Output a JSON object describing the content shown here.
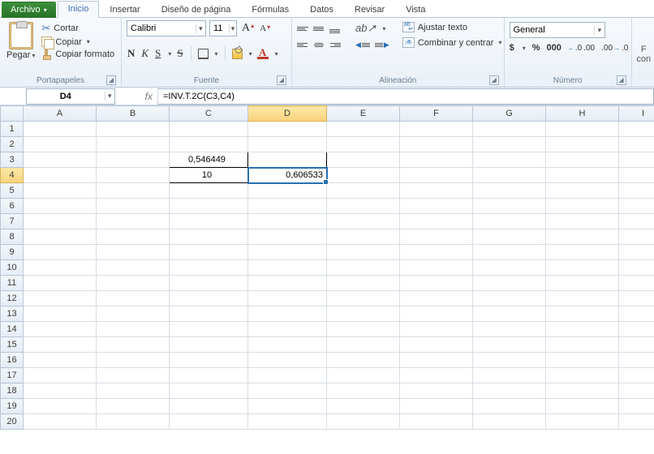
{
  "tabs": {
    "file": "Archivo",
    "items": [
      "Inicio",
      "Insertar",
      "Diseño de página",
      "Fórmulas",
      "Datos",
      "Revisar",
      "Vista"
    ],
    "active": 0
  },
  "ribbon": {
    "clipboard": {
      "label": "Portapapeles",
      "paste": "Pegar",
      "cut": "Cortar",
      "copy": "Copiar",
      "format_painter": "Copiar formato"
    },
    "font": {
      "label": "Fuente",
      "name": "Calibri",
      "size": "11",
      "bold": "N",
      "italic": "K",
      "underline": "S",
      "strike": "S"
    },
    "alignment": {
      "label": "Alineación",
      "wrap": "Ajustar texto",
      "merge": "Combinar y centrar"
    },
    "number": {
      "label": "Número",
      "format": "General",
      "currency": "$",
      "percent": "%",
      "thousands": "000"
    },
    "cells": {
      "line1": "F",
      "line2": "con"
    }
  },
  "namebox": "D4",
  "formula": "=INV.T.2C(C3,C4)",
  "columns": [
    "A",
    "B",
    "C",
    "D",
    "E",
    "F",
    "G",
    "H",
    "I"
  ],
  "rows": 20,
  "cells": {
    "C3": "0,546449",
    "C4": "10",
    "D4": "0,606533"
  },
  "selected": "D4"
}
